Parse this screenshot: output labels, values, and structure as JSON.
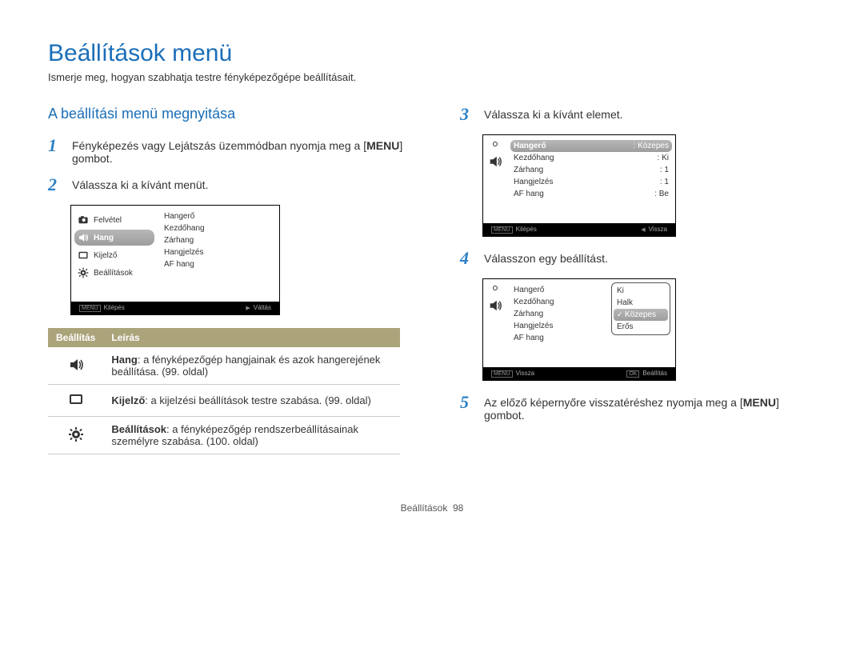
{
  "page_title": "Beállítások menü",
  "lead": "Ismerje meg, hogyan szabhatja testre fényképezőgépe beállításait.",
  "section_heading": "A beállítási menü megnyitása",
  "steps": {
    "1": {
      "num": "1",
      "pre": "Fényképezés vagy Lejátszás üzemmódban nyomja meg a ",
      "menu_label": "MENU",
      "post": " gombot."
    },
    "2": {
      "num": "2",
      "text": "Válassza ki a kívánt menüt."
    },
    "3": {
      "num": "3",
      "text": "Válassza ki a kívánt elemet."
    },
    "4": {
      "num": "4",
      "text": "Válasszon egy beállítást."
    },
    "5": {
      "num": "5",
      "pre": "Az előző képernyőre visszatéréshez nyomja meg a ",
      "menu_label": "MENU",
      "post": " gombot."
    }
  },
  "lcd2": {
    "left_items": [
      {
        "icon": "camera",
        "label": "Felvétel"
      },
      {
        "icon": "sound",
        "label": "Hang",
        "selected": true
      },
      {
        "icon": "display",
        "label": "Kijelző"
      },
      {
        "icon": "gear",
        "label": "Beállítások"
      }
    ],
    "right_items": [
      "Hangerő",
      "Kezdőhang",
      "Zárhang",
      "Hangjelzés",
      "AF hang"
    ],
    "footer_left_btn": "MENU",
    "footer_left": "Kilépés",
    "footer_right": "Váltás"
  },
  "lcd3": {
    "rows": [
      {
        "k": "Hangerő",
        "v": ": Közepes",
        "selected": true
      },
      {
        "k": "Kezdőhang",
        "v": ": Ki"
      },
      {
        "k": "Zárhang",
        "v": ": 1"
      },
      {
        "k": "Hangjelzés",
        "v": ": 1"
      },
      {
        "k": "AF hang",
        "v": ": Be"
      }
    ],
    "footer_left_btn": "MENU",
    "footer_left": "Kilépés",
    "footer_right": "Vissza"
  },
  "lcd4": {
    "rows": [
      {
        "k": "Hangerő"
      },
      {
        "k": "Kezdőhang"
      },
      {
        "k": "Zárhang"
      },
      {
        "k": "Hangjelzés"
      },
      {
        "k": "AF hang"
      }
    ],
    "popup": [
      "Ki",
      "Halk",
      "Közepes",
      "Erős"
    ],
    "popup_selected_index": 2,
    "footer_left_btn": "MENU",
    "footer_left": "Vissza",
    "footer_right_btn": "OK",
    "footer_right": "Beállítás"
  },
  "desc_table": {
    "headers": [
      "Beállítás",
      "Leírás"
    ],
    "rows": [
      {
        "icon": "sound",
        "bold": "Hang",
        "text": ": a fényképezőgép hangjainak és azok hangerejének beállítása. (99. oldal)"
      },
      {
        "icon": "display",
        "bold": "Kijelző",
        "text": ": a kijelzési beállítások testre szabása. (99. oldal)"
      },
      {
        "icon": "gear",
        "bold": "Beállítások",
        "text": ": a fényképezőgép rendszerbeállításainak személyre szabása. (100. oldal)"
      }
    ]
  },
  "page_foot": {
    "label": "Beállítások",
    "page": "98"
  }
}
